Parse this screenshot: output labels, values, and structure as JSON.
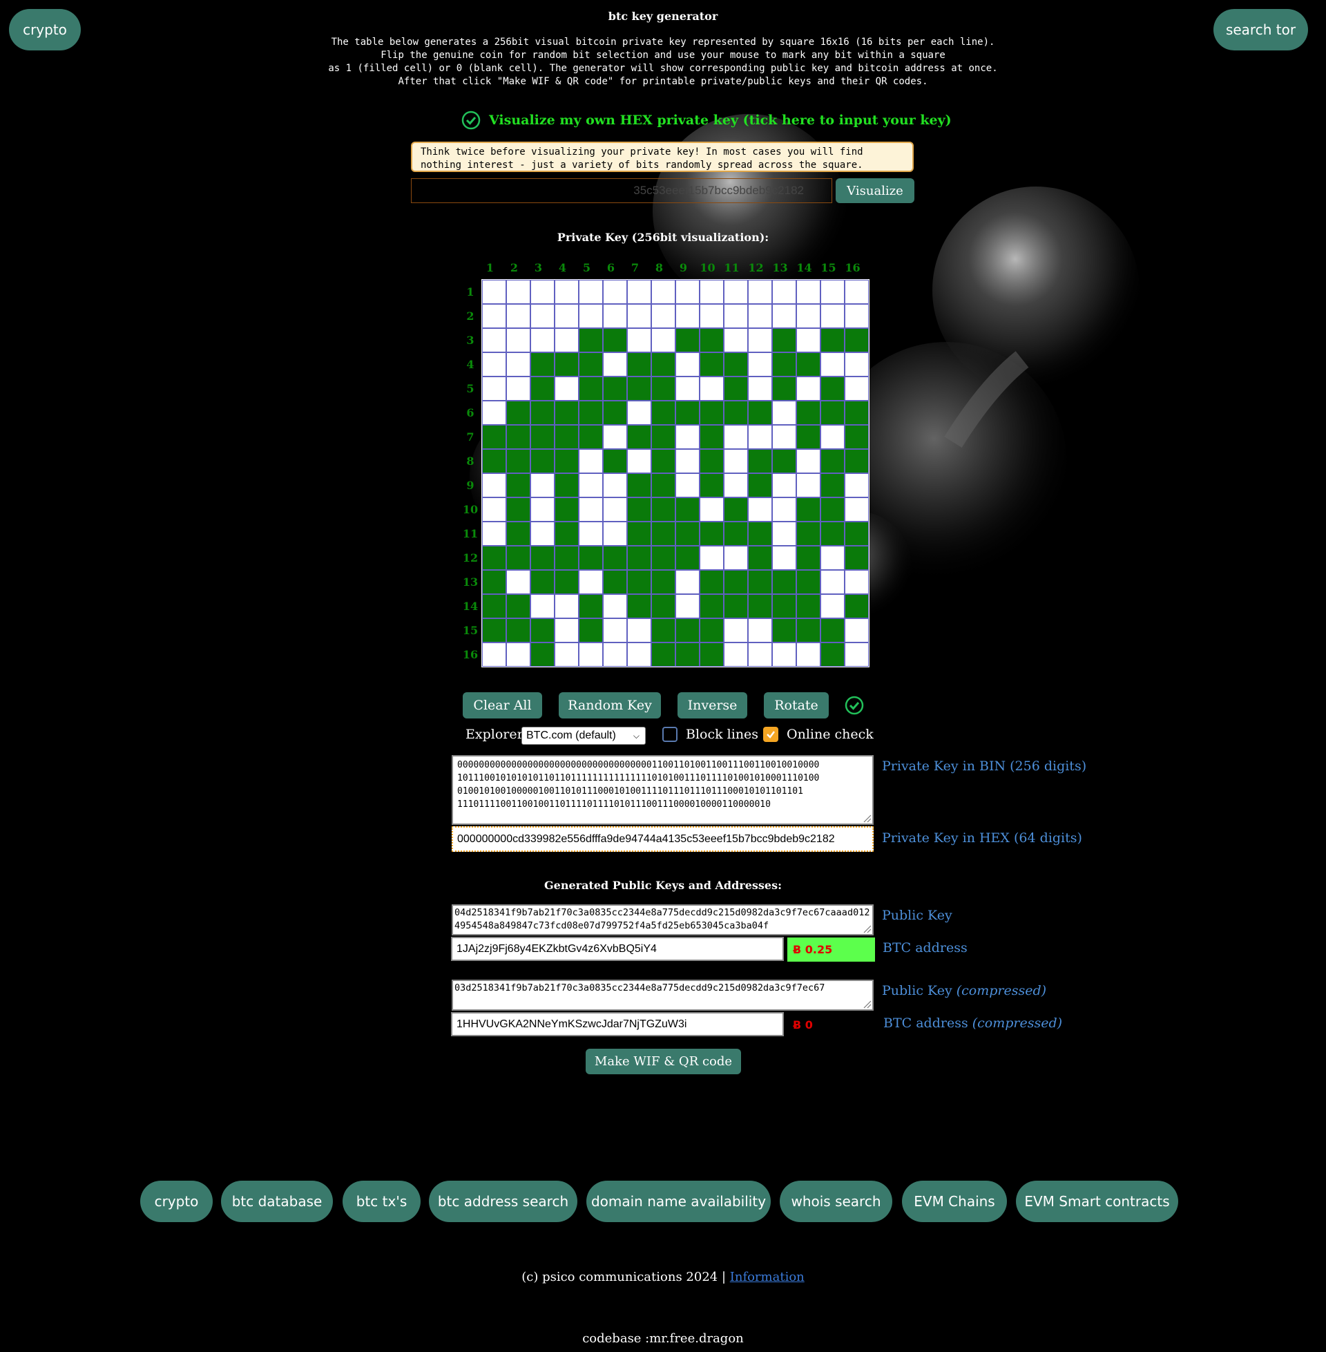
{
  "nav": {
    "crypto_label": "crypto",
    "search_tor_label": "search tor"
  },
  "header": {
    "title": "btc key generator",
    "intro": "The table below generates a 256bit visual bitcoin private key represented by square 16x16 (16 bits per each line).\nFlip the genuine coin for random bit selection and use your mouse to mark any bit within a square\nas 1 (filled cell) or 0 (blank cell). The generator will show corresponding public key and bitcoin address at once.\nAfter that click \"Make WIF & QR code\" for printable private/public keys and their QR codes."
  },
  "visualize_own": {
    "label": "Visualize my own HEX private key (tick here to input your key)",
    "checked": true,
    "warning": "Think twice before visualizing your private key! In most cases you will find nothing interest - just a variety of bits randomly spread across the square.",
    "input_value": "35c53eeef15b7bcc9bdeb9c2182",
    "visualize_label": "Visualize"
  },
  "grid": {
    "title": "Private Key (256bit visualization):",
    "column_labels": [
      "1",
      "2",
      "3",
      "4",
      "5",
      "6",
      "7",
      "8",
      "9",
      "10",
      "11",
      "12",
      "13",
      "14",
      "15",
      "16"
    ],
    "row_labels": [
      "1",
      "2",
      "3",
      "4",
      "5",
      "6",
      "7",
      "8",
      "9",
      "10",
      "11",
      "12",
      "13",
      "14",
      "15",
      "16"
    ],
    "rows": [
      "0000000000000000",
      "0000000000000000",
      "0000110011001011",
      "0011101101101100",
      "0010111100101010",
      "0111110111110111",
      "1111101101000101",
      "1111010101011011",
      "0101001101010010",
      "0101001110100110",
      "0101001111110111",
      "1111111110010101",
      "1011011101111100",
      "1100101101111101",
      "1110100111001110",
      "0010000111000010"
    ],
    "colors": {
      "on": "#0a7a0a",
      "off": "#ffffff"
    }
  },
  "controls": {
    "clear_all": "Clear All",
    "random_key": "Random Key",
    "inverse": "Inverse",
    "rotate": "Rotate",
    "explorer_label": "Explorer:",
    "explorer_selected": "BTC.com (default)",
    "block_lines_label": "Block lines",
    "block_lines_checked": false,
    "online_check_label": "Online check",
    "online_check_checked": true
  },
  "private_key": {
    "bin_lines": [
      "0000000000000000000000000000000000001100110100110011100110010010000",
      "1011100101010101101101111111111111110101001110111101001010001110100",
      "0100101001000001001101011100010100111101110111011100010101101101",
      "1110111100110010011011110111101011100111000010000110000010"
    ],
    "bin_label": "Private Key in BIN (256 digits)",
    "hex": "000000000cd339982e556dfffa9de94744a4135c53eeef15b7bcc9bdeb9c2182",
    "hex_label": "Private Key in HEX (64 digits)"
  },
  "public": {
    "title": "Generated Public Keys and Addresses:",
    "pubkey": "04d2518341f9b7ab21f70c3a0835cc2344e8a775decdd9c215d0982da3c9f7ec67caaad0124954548a849847c73fcd08e07d799752f4a5fd25eb653045ca3ba04f",
    "pubkey_label": "Public Key",
    "address": "1JAj2zj9Fj68y4EKZkbtGv4z6XvbBQ5iY4",
    "address_label": "BTC address",
    "address_balance": "Ƀ 0.25",
    "pubkey_compressed": "03d2518341f9b7ab21f70c3a0835cc2344e8a775decdd9c215d0982da3c9f7ec67",
    "pubkey_compressed_label": "Public Key",
    "address_compressed": "1HHVUvGKA2NNeYmKSzwcJdar7NjTGZuW3i",
    "address_compressed_label": "BTC address",
    "compressed_suffix": "(compressed)",
    "address_compressed_balance": "Ƀ 0",
    "make_wif": "Make WIF & QR code",
    "balance_color": "#5cff4c"
  },
  "bottom_nav": [
    "crypto",
    "btc database",
    "btc tx's",
    "btc address search",
    "domain name availability",
    "whois search",
    "EVM Chains",
    "EVM Smart contracts"
  ],
  "footer": {
    "copyright": "(c) psico communications 2024 | ",
    "info_link": "Information",
    "codebase": "codebase :mr.free.dragon"
  },
  "colors": {
    "accent": "#3a7a6c",
    "grid_label": "#0a8a0a",
    "link": "#4d8fd9",
    "bright_green": "#22e022"
  }
}
